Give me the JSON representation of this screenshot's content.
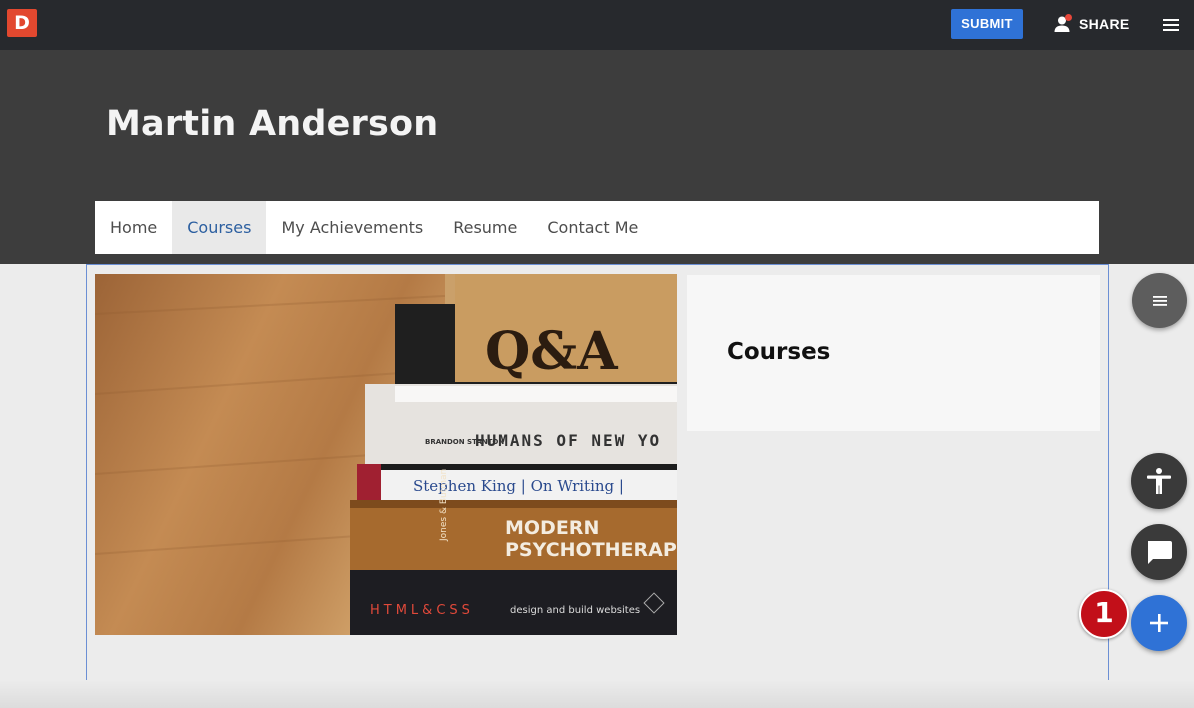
{
  "topbar": {
    "logo_letter": "D",
    "submit_label": "SUBMIT",
    "share_label": "SHARE"
  },
  "header": {
    "title": "Martin Anderson"
  },
  "nav": {
    "items": [
      {
        "label": "Home"
      },
      {
        "label": "Courses"
      },
      {
        "label": "My Achievements"
      },
      {
        "label": "Resume"
      },
      {
        "label": "Contact Me"
      }
    ],
    "active": "Courses"
  },
  "main": {
    "card_title": "Courses",
    "image": {
      "book_spines": [
        "Q&A",
        "BRANDON STANTON",
        "HUMANS OF NEW YO",
        "Stephen King | On Writing |",
        "Jones & Butman",
        "MODERN",
        "PSYCHOTHERAPI",
        "HTML&CSS",
        "design and build websites"
      ]
    }
  },
  "badge": {
    "count": "1"
  },
  "colors": {
    "topbar": "#27292d",
    "hero": "#3d3d3d",
    "accent": "#2f72d6",
    "logo": "#e2482f",
    "badge": "#c20f19"
  }
}
